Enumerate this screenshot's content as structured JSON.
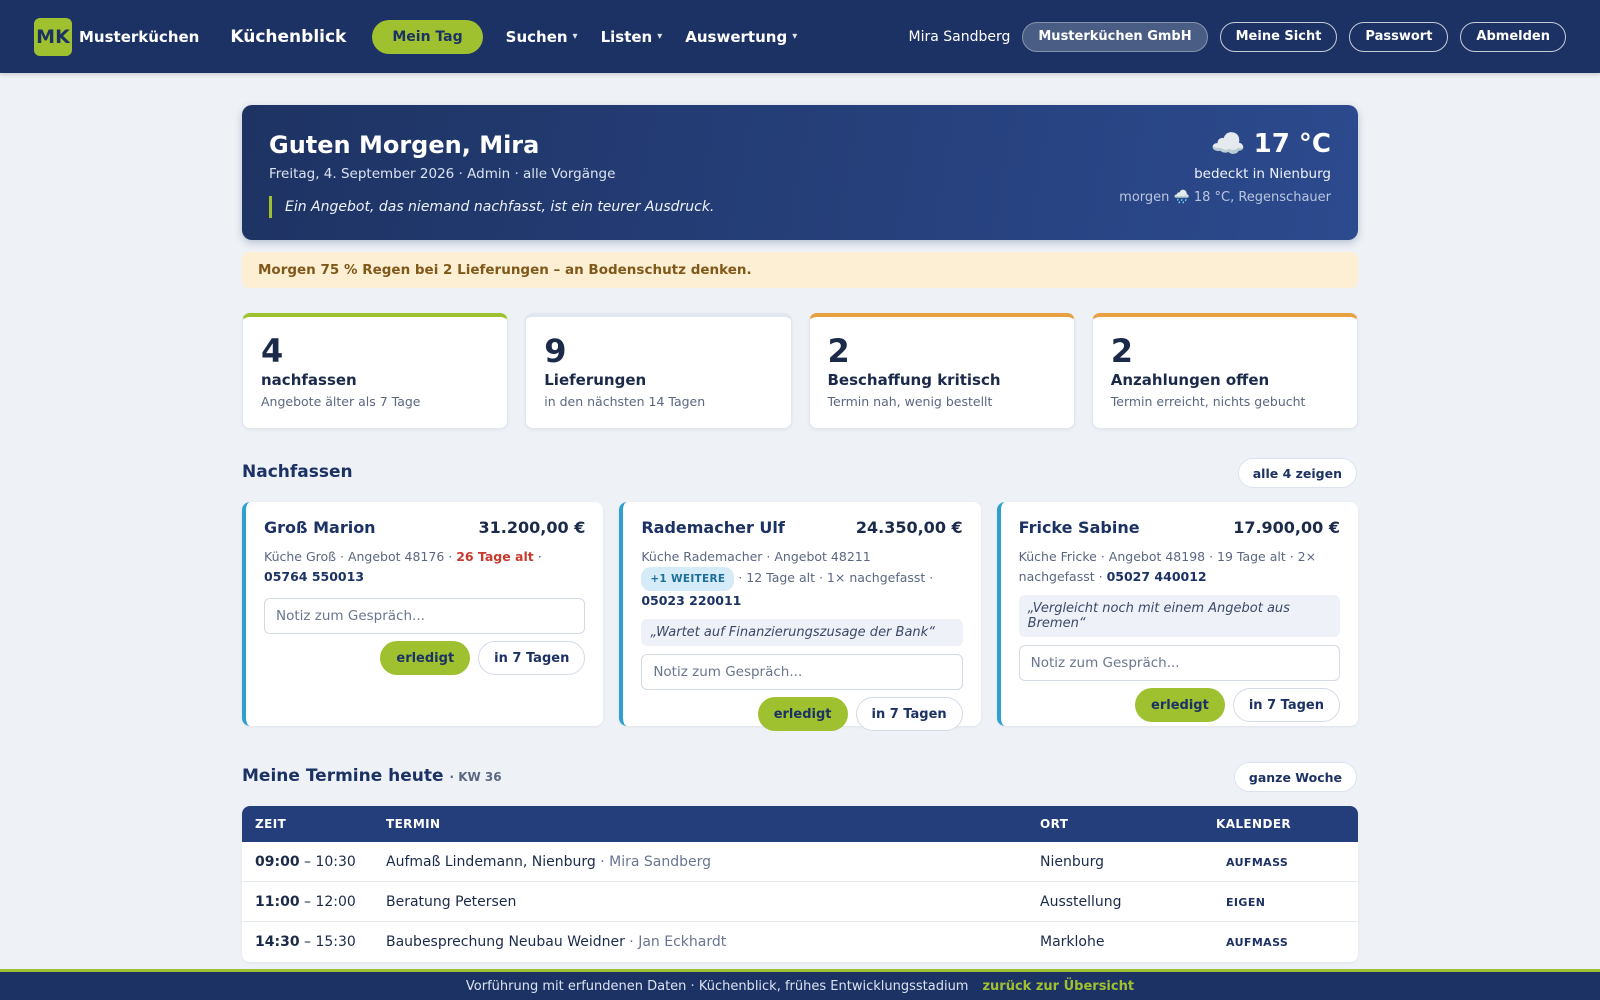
{
  "nav": {
    "logo_initials": "MK",
    "logo_text": "Musterküchen",
    "product": "Küchenblick",
    "active": "Mein Tag",
    "menus": [
      "Suchen",
      "Listen",
      "Auswertung"
    ],
    "caret": "▾",
    "user": "Mira Sandberg",
    "company": "Musterküchen GmbH",
    "buttons": [
      "Meine Sicht",
      "Passwort",
      "Abmelden"
    ]
  },
  "hero": {
    "greeting": "Guten Morgen, Mira",
    "subtitle": "Freitag, 4. September 2026 · Admin · alle Vorgänge",
    "quote": "Ein Angebot, das niemand nachfasst, ist ein teurer Ausdruck.",
    "weather_icon": "☁️",
    "temperature": "17 °C",
    "weather_desc": "bedeckt in Nienburg",
    "tomorrow": "morgen 🌧️ 18 °C, Regenschauer"
  },
  "warning": "Morgen 75 % Regen bei 2 Lieferungen – an Bodenschutz denken.",
  "stats": [
    {
      "num": "4",
      "label": "nachfassen",
      "sub": "Angebote älter als 7 Tage",
      "accent": "#9fc12f"
    },
    {
      "num": "9",
      "label": "Lieferungen",
      "sub": "in den nächsten 14 Tagen",
      "accent": "#e1e7f0"
    },
    {
      "num": "2",
      "label": "Beschaffung kritisch",
      "sub": "Termin nah, wenig bestellt",
      "accent": "#e8a040"
    },
    {
      "num": "2",
      "label": "Anzahlungen offen",
      "sub": "Termin erreicht, nichts gebucht",
      "accent": "#e8a040"
    }
  ],
  "followup": {
    "title": "Nachfassen",
    "show_all": "alle 4 zeigen",
    "note_placeholder": "Notiz zum Gespräch...",
    "done_label": "erledigt",
    "later_label": "in 7 Tagen",
    "cards": [
      {
        "name": "Groß Marion",
        "amount": "31.200,00 €",
        "meta_a": "Küche Groß · Angebot 48176 · ",
        "age": "26 Tage alt",
        "meta_b": " · ",
        "phone": "05764 550013"
      },
      {
        "name": "Rademacher Ulf",
        "amount": "24.350,00 €",
        "meta_a": "Küche Rademacher · Angebot 48211 ",
        "badge": "+1 WEITERE",
        "meta_b": " · 12 Tage alt · 1× nachgefasst · ",
        "phone": "05023 220011",
        "quote": "„Wartet auf Finanzierungszusage der Bank“"
      },
      {
        "name": "Fricke Sabine",
        "amount": "17.900,00 €",
        "meta_a": "Küche Fricke · Angebot 48198 · 19 Tage alt · 2× nachgefasst · ",
        "phone": "05027 440012",
        "quote": "„Vergleicht noch mit einem Angebot aus Bremen“"
      }
    ]
  },
  "appointments": {
    "title": "Meine Termine heute",
    "kw": "· KW 36",
    "week_button": "ganze Woche",
    "headers": [
      "ZEIT",
      "TERMIN",
      "ORT",
      "KALENDER"
    ],
    "rows": [
      {
        "start": "09:00",
        "end": " – 10:30",
        "title": "Aufmaß Lindemann, Nienburg",
        "person": " · Mira Sandberg",
        "place": "Nienburg",
        "calendar": "AUFMASS"
      },
      {
        "start": "11:00",
        "end": " – 12:00",
        "title": "Beratung Petersen",
        "person": "",
        "place": "Ausstellung",
        "calendar": "EIGEN"
      },
      {
        "start": "14:30",
        "end": " – 15:30",
        "title": "Baubesprechung Neubau Weidner",
        "person": " · Jan Eckhardt",
        "place": "Marklohe",
        "calendar": "AUFMASS"
      }
    ]
  },
  "footer": {
    "text": "Vorführung mit erfundenen Daten · Küchenblick, frühes Entwicklungsstadium",
    "link": "zurück zur Übersicht"
  },
  "colors": {
    "navy": "#1d3264",
    "lime": "#9fc12f",
    "orange": "#e8a040",
    "cyan": "#2e9fd0",
    "red": "#c63b2e"
  }
}
